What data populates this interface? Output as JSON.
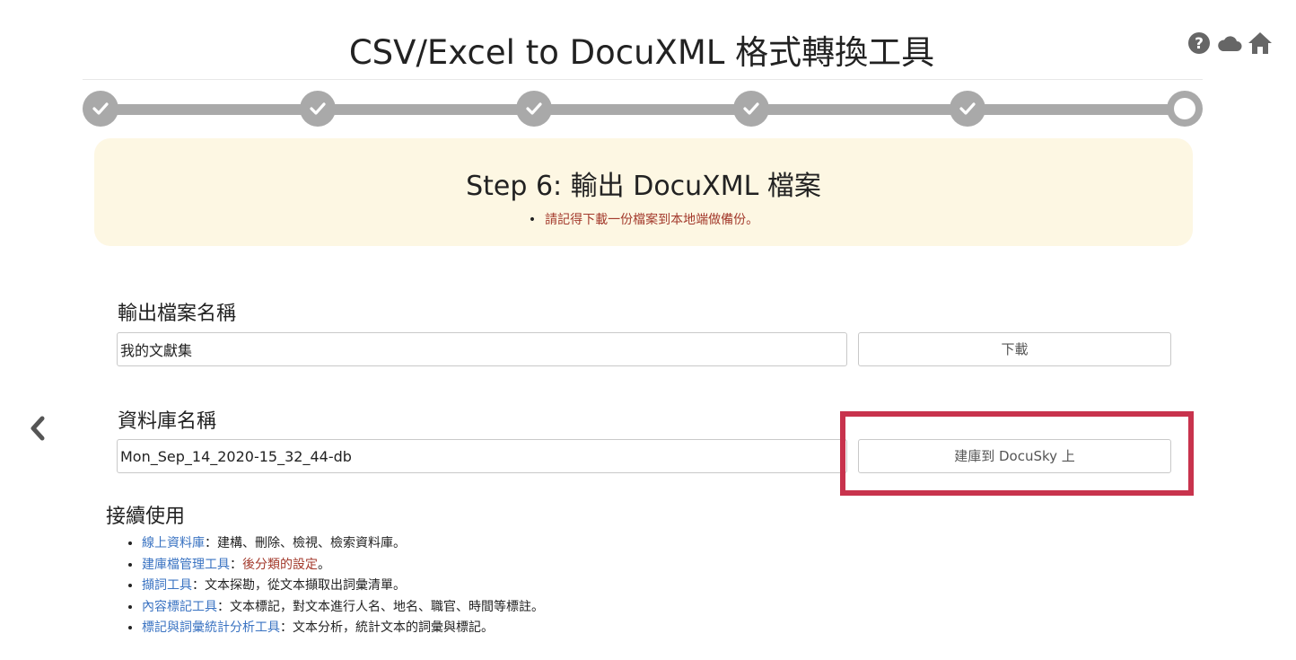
{
  "header": {
    "title": "CSV/Excel to DocuXML 格式轉換工具",
    "icons": [
      "help-icon",
      "cloud-icon",
      "home-icon"
    ]
  },
  "stepper": {
    "total_steps": 6,
    "completed_steps": 5,
    "current_step": 6,
    "color": "#a9a9a9"
  },
  "step_box": {
    "title": "Step 6: 輸出 DocuXML 檔案",
    "note": "請記得下載一份檔案到本地端做備份。",
    "background": "#fdf7e3"
  },
  "output_file": {
    "label": "輸出檔案名稱",
    "value": "我的文獻集",
    "download_label": "下載"
  },
  "database": {
    "label": "資料庫名稱",
    "value": "Mon_Sep_14_2020-15_32_44-db",
    "build_label": "建庫到 DocuSky 上"
  },
  "next_steps": {
    "title": "接續使用",
    "items": [
      {
        "link": "線上資料庫",
        "sep": "：",
        "desc": "建構、刪除、檢視、檢索資料庫。"
      },
      {
        "link": "建庫檔管理工具",
        "sep": "：",
        "desc_red": "後分類的設定",
        "desc": "。"
      },
      {
        "link": "擷詞工具",
        "sep": "：",
        "desc": "文本探勘，從文本擷取出詞彙清單。"
      },
      {
        "link": "內容標記工具",
        "sep": "：",
        "desc": "文本標記，對文本進行人名、地名、職官、時間等標註。"
      },
      {
        "link": "標記與詞彙統計分析工具",
        "sep": "：",
        "desc": "文本分析，統計文本的詞彙與標記。"
      }
    ]
  },
  "colors": {
    "link": "#3a73c2",
    "warning": "#a33a2c",
    "highlight": "#c8334d"
  }
}
